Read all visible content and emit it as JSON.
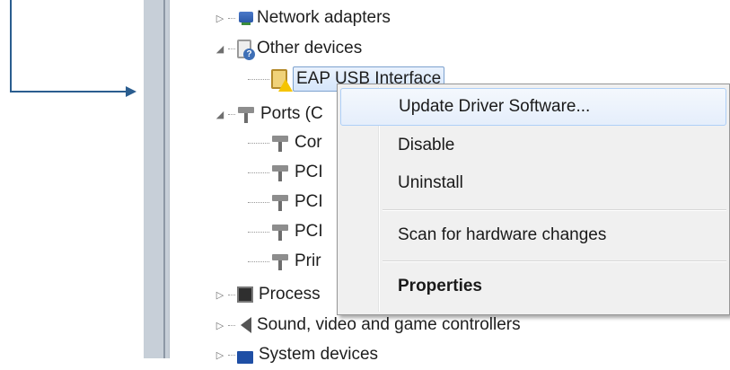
{
  "tree": {
    "items": [
      {
        "label": "Network adapters",
        "expander": "▷",
        "icon": "network-adapter-icon"
      },
      {
        "label": "Other devices",
        "expander": "◢",
        "icon": "unknown-device-icon"
      },
      {
        "label": "EAP USB Interface",
        "icon": "warning-device-icon"
      },
      {
        "label": "Ports (C",
        "expander": "◢",
        "icon": "port-icon"
      },
      {
        "label": "Cor",
        "icon": "port-icon"
      },
      {
        "label": "PCI",
        "icon": "port-icon"
      },
      {
        "label": "PCI",
        "icon": "port-icon"
      },
      {
        "label": "PCI",
        "icon": "port-icon"
      },
      {
        "label": "Prir",
        "icon": "port-icon"
      },
      {
        "label": "Process",
        "expander": "▷",
        "icon": "processor-icon"
      },
      {
        "label": "Sound, video and game controllers",
        "expander": "▷",
        "icon": "speaker-icon"
      },
      {
        "label": "System devices",
        "expander": "▷",
        "icon": "system-device-icon"
      }
    ]
  },
  "context_menu": {
    "update_driver": "Update Driver Software...",
    "disable": "Disable",
    "uninstall": "Uninstall",
    "scan": "Scan for hardware changes",
    "properties": "Properties"
  },
  "colors": {
    "callout_arrow": "#2a5d8f",
    "menu_highlight": "#aecff7"
  }
}
